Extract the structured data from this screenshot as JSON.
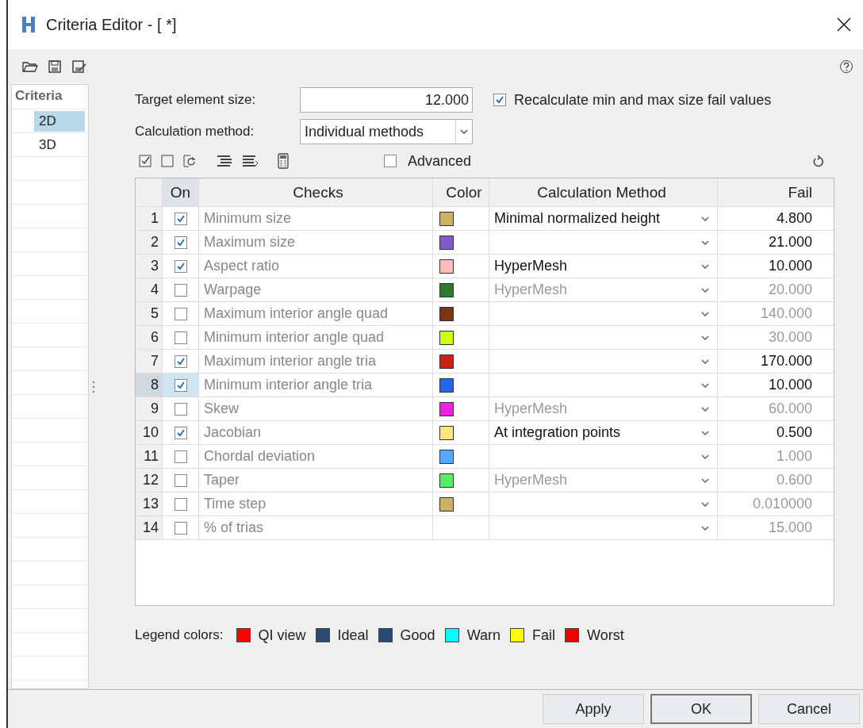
{
  "window": {
    "title": "Criteria Editor - [ *]"
  },
  "sidebar": {
    "header": "Criteria",
    "items": [
      {
        "label": "2D",
        "selected": true
      },
      {
        "label": "3D",
        "selected": false
      }
    ]
  },
  "target_size": {
    "label": "Target element size:",
    "value": "12.000"
  },
  "recalculate": {
    "label": "Recalculate min and max size fail values",
    "checked": true
  },
  "calc_method": {
    "label": "Calculation method:",
    "value": "Individual methods"
  },
  "advanced": {
    "label": "Advanced",
    "checked": false
  },
  "table": {
    "columns": [
      "On",
      "Checks",
      "Color",
      "Calculation Method",
      "Fail"
    ],
    "rows": [
      {
        "index": "1",
        "on": true,
        "selected": false,
        "check": "Minimum size",
        "color": "#cbb066",
        "method": "Minimal normalized height",
        "fail": "4.800"
      },
      {
        "index": "2",
        "on": true,
        "selected": false,
        "check": "Maximum size",
        "color": "#7b5cc8",
        "method": "",
        "fail": "21.000"
      },
      {
        "index": "3",
        "on": true,
        "selected": false,
        "check": "Aspect ratio",
        "color": "#ffbcbc",
        "method": "HyperMesh",
        "fail": "10.000"
      },
      {
        "index": "4",
        "on": false,
        "selected": false,
        "check": "Warpage",
        "color": "#2d7a2d",
        "method": "HyperMesh",
        "fail": "20.000"
      },
      {
        "index": "5",
        "on": false,
        "selected": false,
        "check": "Maximum interior angle quad",
        "color": "#7a3416",
        "method": "",
        "fail": "140.000"
      },
      {
        "index": "6",
        "on": false,
        "selected": false,
        "check": "Minimum interior angle quad",
        "color": "#ccff11",
        "method": "",
        "fail": "30.000"
      },
      {
        "index": "7",
        "on": true,
        "selected": false,
        "check": "Maximum interior angle tria",
        "color": "#cc2211",
        "method": "",
        "fail": "170.000"
      },
      {
        "index": "8",
        "on": true,
        "selected": true,
        "check": "Minimum interior angle tria",
        "color": "#2266ee",
        "method": "",
        "fail": "10.000"
      },
      {
        "index": "9",
        "on": false,
        "selected": false,
        "check": "Skew",
        "color": "#ee22dd",
        "method": "HyperMesh",
        "fail": "60.000"
      },
      {
        "index": "10",
        "on": true,
        "selected": false,
        "check": "Jacobian",
        "color": "#ffe680",
        "method": "At integration points",
        "fail": "0.500"
      },
      {
        "index": "11",
        "on": false,
        "selected": false,
        "check": "Chordal deviation",
        "color": "#55aaff",
        "method": "",
        "fail": "1.000"
      },
      {
        "index": "12",
        "on": false,
        "selected": false,
        "check": "Taper",
        "color": "#55ee66",
        "method": "HyperMesh",
        "fail": "0.600"
      },
      {
        "index": "13",
        "on": false,
        "selected": false,
        "check": "Time step",
        "color": "#cbb066",
        "method": "",
        "fail": "0.010000"
      },
      {
        "index": "14",
        "on": false,
        "selected": false,
        "check": "% of trias",
        "method": "",
        "fail": "15.000"
      }
    ]
  },
  "legend": {
    "label": "Legend colors:",
    "items": [
      {
        "label": "QI view",
        "color": "#ff0000"
      },
      {
        "label": "Ideal",
        "color": "#2a4a74"
      },
      {
        "label": "Good",
        "color": "#2a4a74"
      },
      {
        "label": "Warn",
        "color": "#00ffff"
      },
      {
        "label": "Fail",
        "color": "#ffff00"
      },
      {
        "label": "Worst",
        "color": "#ee0000"
      }
    ]
  },
  "buttons": [
    "Apply",
    "OK",
    "Cancel"
  ]
}
